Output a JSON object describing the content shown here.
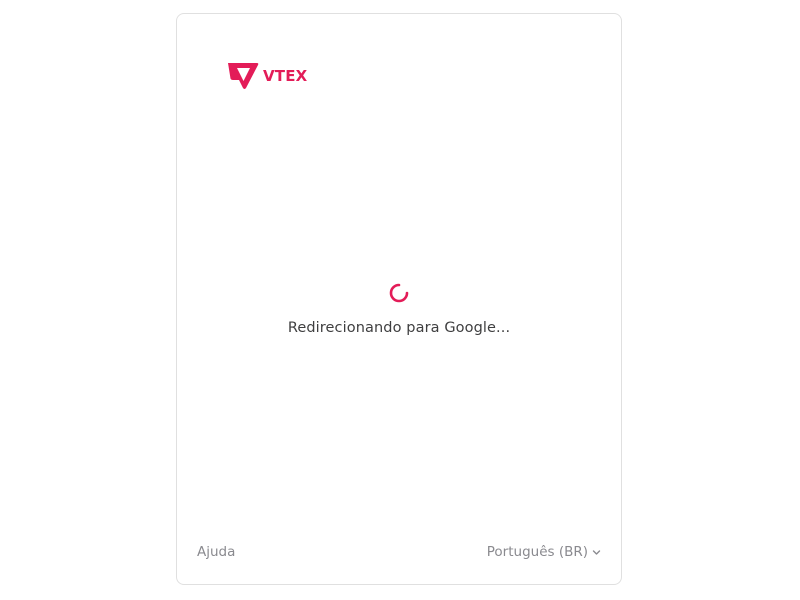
{
  "brand": {
    "name": "VTEX",
    "color": "#e31c58",
    "icon": "vtex-logo-icon"
  },
  "status": {
    "message": "Redirecionando para Google...",
    "icon": "loading-spinner-icon",
    "color": "#e31c58"
  },
  "footer": {
    "help_label": "Ajuda",
    "language_label": "Português (BR)",
    "language_icon": "chevron-down-icon"
  }
}
